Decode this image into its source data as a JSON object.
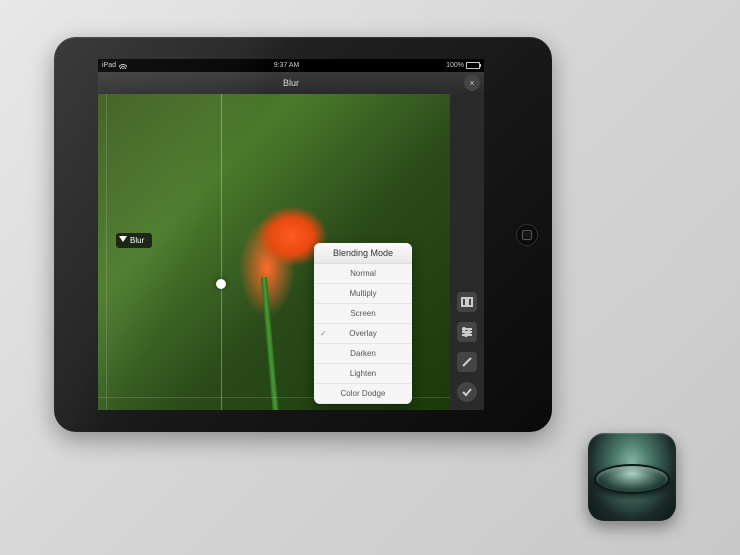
{
  "statusbar": {
    "device": "iPad",
    "time": "9:37 AM",
    "battery": "100%"
  },
  "header": {
    "title": "Blur",
    "close": "×"
  },
  "slider": {
    "label": "Blur"
  },
  "popover": {
    "title": "Blending Mode",
    "items": [
      "Normal",
      "Multiply",
      "Screen",
      "Overlay",
      "Darken",
      "Lighten",
      "Color Dodge"
    ],
    "selected": 3
  },
  "tools": [
    {
      "name": "compare-tool"
    },
    {
      "name": "sliders-tool"
    },
    {
      "name": "brush-tool"
    },
    {
      "name": "apply-tool"
    }
  ]
}
